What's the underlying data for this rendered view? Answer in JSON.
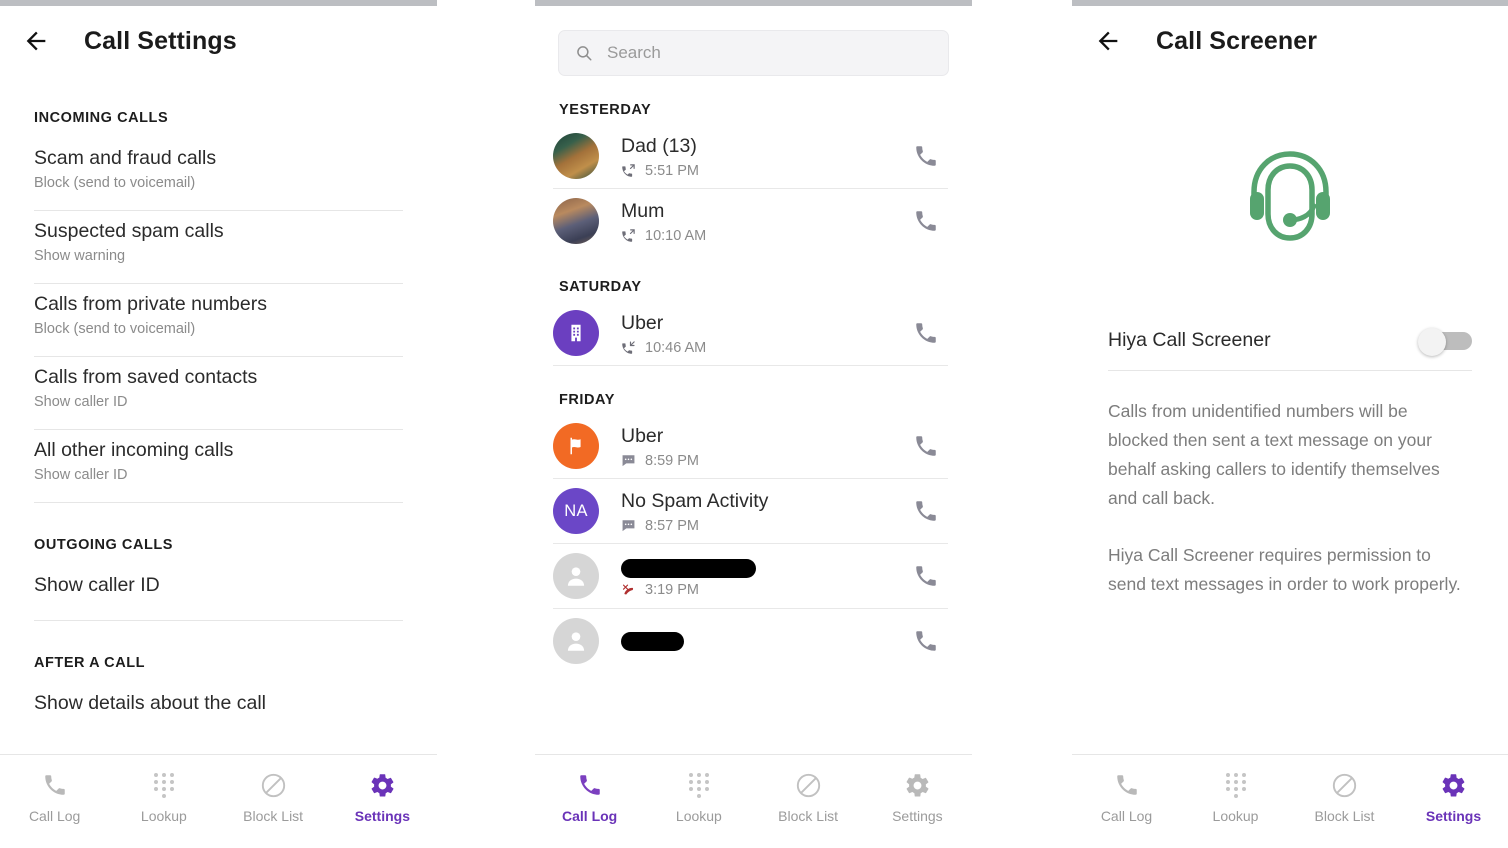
{
  "panels": {
    "settings": {
      "title": "Call Settings",
      "back_icon": "back-arrow-icon",
      "sections": [
        {
          "heading": "INCOMING CALLS",
          "rows": [
            {
              "title": "Scam and fraud calls",
              "sub": "Block (send to voicemail)"
            },
            {
              "title": "Suspected spam calls",
              "sub": "Show warning"
            },
            {
              "title": "Calls from private numbers",
              "sub": "Block (send to voicemail)"
            },
            {
              "title": "Calls from saved contacts",
              "sub": "Show caller ID"
            },
            {
              "title": "All other incoming calls",
              "sub": "Show caller ID"
            }
          ]
        },
        {
          "heading": "OUTGOING CALLS",
          "rows": [
            {
              "title": "Show caller ID",
              "sub": ""
            }
          ]
        },
        {
          "heading": "AFTER A CALL",
          "rows": [
            {
              "title": "Show details about the call",
              "sub": ""
            }
          ]
        }
      ]
    },
    "calllog": {
      "search": {
        "value": "",
        "placeholder": "Search",
        "icon": "search-icon"
      },
      "groups": [
        {
          "day": "YESTERDAY",
          "entries": [
            {
              "name": "Dad (13)",
              "time": "5:51 PM",
              "call_type": "outgoing",
              "avatar": "photo-dog",
              "redacted": false
            },
            {
              "name": "Mum",
              "time": "10:10 AM",
              "call_type": "outgoing",
              "avatar": "photo-person",
              "redacted": false
            }
          ]
        },
        {
          "day": "SATURDAY",
          "entries": [
            {
              "name": "Uber",
              "time": "10:46 AM",
              "call_type": "incoming",
              "avatar": "business-purple",
              "redacted": false
            }
          ]
        },
        {
          "day": "FRIDAY",
          "entries": [
            {
              "name": "Uber",
              "time": "8:59 PM",
              "call_type": "message",
              "avatar": "flag-orange",
              "redacted": false
            },
            {
              "name": "No Spam Activity",
              "time": "8:57 PM",
              "call_type": "message",
              "avatar": "initials-NA",
              "avatar_initials": "NA",
              "redacted": false
            },
            {
              "name": "",
              "time": "3:19 PM",
              "call_type": "missed",
              "avatar": "person-gray",
              "redacted": "long"
            },
            {
              "name": "",
              "time": "",
              "call_type": "",
              "avatar": "person-gray",
              "redacted": "short"
            }
          ]
        }
      ]
    },
    "screener": {
      "title": "Call Screener",
      "back_icon": "back-arrow-icon",
      "hero_icon": "headset-icon",
      "toggle_label": "Hiya Call Screener",
      "toggle_state": "off",
      "paragraphs": [
        "Calls from unidentified numbers will be blocked then sent a text message on your behalf asking callers to identify themselves and call back.",
        "Hiya Call Screener requires permission to send text messages in order to work properly."
      ]
    }
  },
  "bottom_nav": {
    "items": [
      {
        "label": "Call Log",
        "icon": "phone-icon"
      },
      {
        "label": "Lookup",
        "icon": "dialpad-icon"
      },
      {
        "label": "Block List",
        "icon": "block-icon"
      },
      {
        "label": "Settings",
        "icon": "gear-icon"
      }
    ],
    "active_settings": "Settings",
    "active_calllog": "Call Log"
  },
  "colors": {
    "accent_purple": "#6a33b8",
    "hero_green": "#56a46f",
    "avatar_purple": "#6b3fc0",
    "avatar_orange": "#f26a24",
    "missed_red": "#b03030",
    "status_bar": "#bcbec2"
  }
}
